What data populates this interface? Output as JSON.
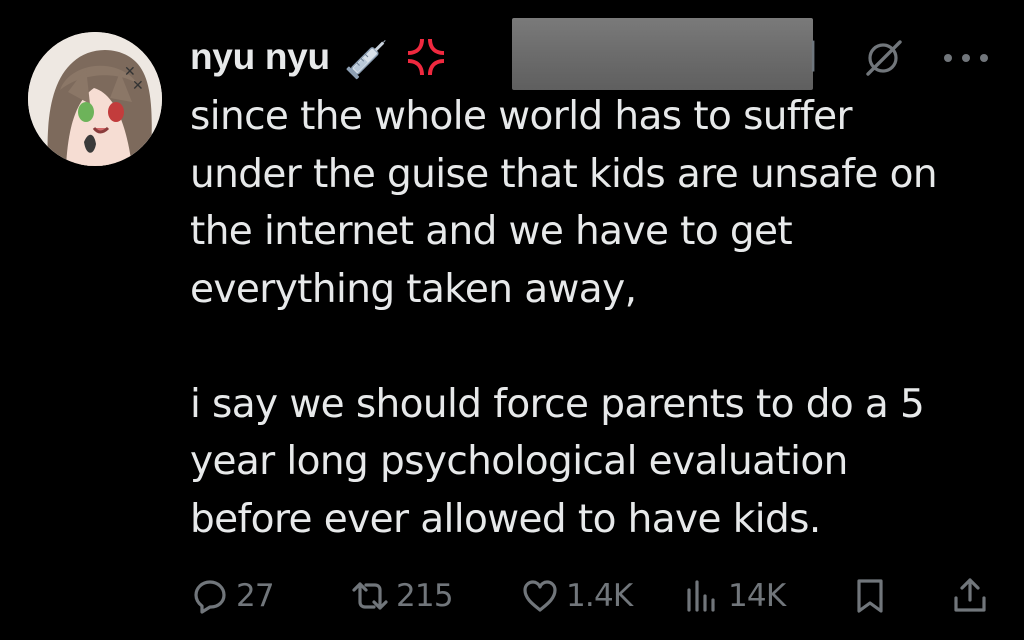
{
  "tweet": {
    "author": {
      "display_name": "nyu nyu",
      "emojis": [
        "syringe-emoji",
        "anger-symbol-emoji"
      ],
      "handle_redacted": true
    },
    "text": "since the whole world has to suffer\nunder the guise that kids are unsafe on\nthe internet and we have to get\neverything taken away,\n\ni say we should force parents to do a 5\nyear long psychological evaluation\nbefore ever allowed to have kids.",
    "stats": {
      "replies": "27",
      "retweets": "215",
      "likes": "1.4K",
      "views": "14K"
    },
    "icons": {
      "reply": "reply-icon",
      "retweet": "retweet-icon",
      "like": "heart-icon",
      "views": "views-icon",
      "bookmark": "bookmark-icon",
      "share": "share-icon",
      "grok": "grok-icon",
      "more": "more-icon"
    }
  },
  "colors": {
    "background": "#000000",
    "text": "#e7e9ea",
    "muted": "#71767b",
    "redaction": "#6c6c6c"
  }
}
